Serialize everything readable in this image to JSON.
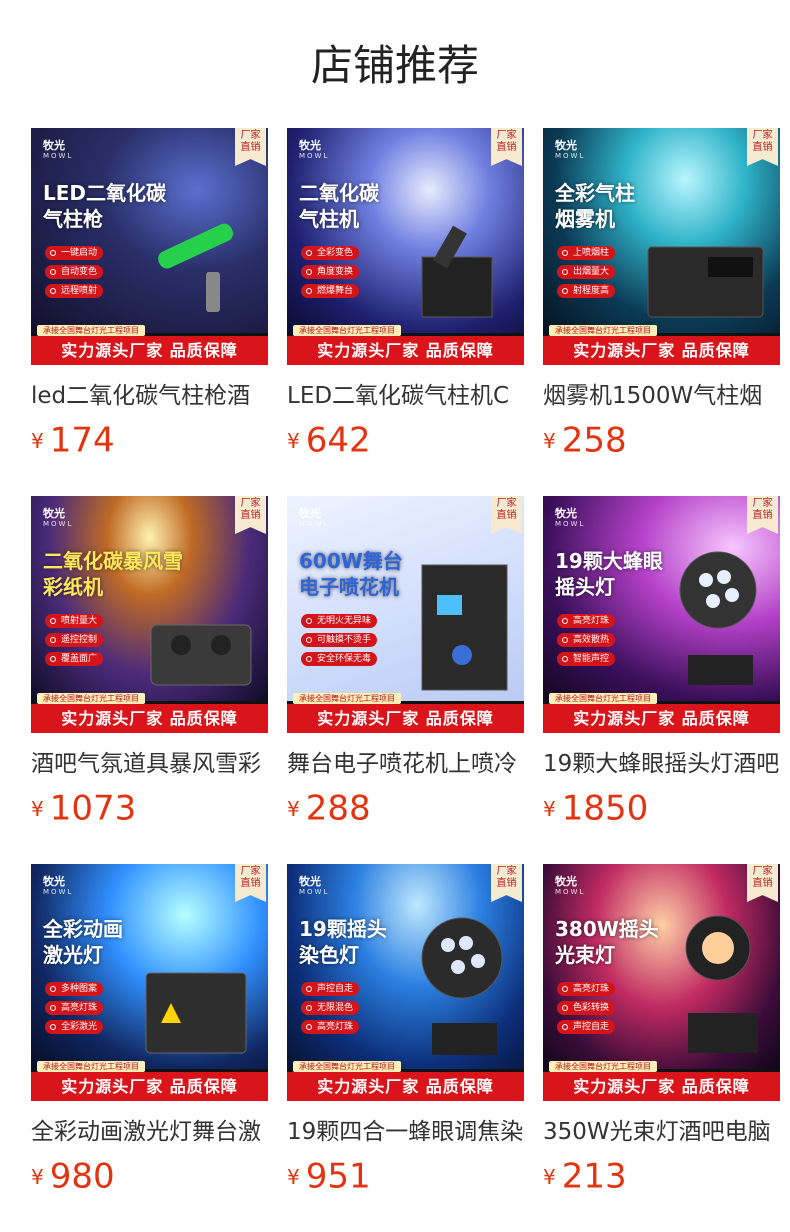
{
  "page": {
    "title": "店铺推荐"
  },
  "common": {
    "brand_logo": "牧光",
    "brand_sub": "MOWL",
    "badge": "厂家\n直销",
    "sub_banner": "承接全国舞台灯光工程项目",
    "banner": "实力源头厂家 品质保障",
    "currency": "¥"
  },
  "products": [
    {
      "headline": "LED二氧化碳\n气柱枪",
      "features": [
        "一键启动",
        "自动变色",
        "远程喷射"
      ],
      "name": "led二氧化碳气柱枪酒",
      "price": "174"
    },
    {
      "headline": "二氧化碳\n气柱机",
      "features": [
        "全彩变色",
        "角度变换",
        "燃爆舞台"
      ],
      "name": "LED二氧化碳气柱机C",
      "price": "642"
    },
    {
      "headline": "全彩气柱\n烟雾机",
      "features": [
        "上喷烟柱",
        "出烟量大",
        "射程度高"
      ],
      "name": "烟雾机1500W气柱烟",
      "price": "258"
    },
    {
      "headline": "二氧化碳暴风雪\n彩纸机",
      "features": [
        "喷射量大",
        "遥控控制",
        "覆盖面广"
      ],
      "name": "酒吧气氛道具暴风雪彩",
      "price": "1073"
    },
    {
      "headline": "600W舞台\n电子喷花机",
      "features": [
        "无明火无异味",
        "可触摸不烫手",
        "安全环保无毒"
      ],
      "name": "舞台电子喷花机上喷冷",
      "price": "288"
    },
    {
      "headline": "19颗大蜂眼\n摇头灯",
      "features": [
        "高亮灯珠",
        "高效散热",
        "智能声控"
      ],
      "name": "19颗大蜂眼摇头灯酒吧",
      "price": "1850"
    },
    {
      "headline": "全彩动画\n激光灯",
      "features": [
        "多种图案",
        "高亮灯珠",
        "全彩激光"
      ],
      "name": "全彩动画激光灯舞台激",
      "price": "980"
    },
    {
      "headline": "19颗摇头\n染色灯",
      "features": [
        "声控自走",
        "无限混色",
        "高亮灯珠"
      ],
      "name": "19颗四合一蜂眼调焦染",
      "price": "951"
    },
    {
      "headline": "380W摇头\n光束灯",
      "features": [
        "高亮灯珠",
        "色彩转换",
        "声控自走"
      ],
      "name": "350W光束灯酒吧电脑",
      "price": "213"
    }
  ],
  "colors": {
    "price": "#e23410",
    "banner": "#d9141b",
    "badge_bg": "#f6ead1"
  }
}
